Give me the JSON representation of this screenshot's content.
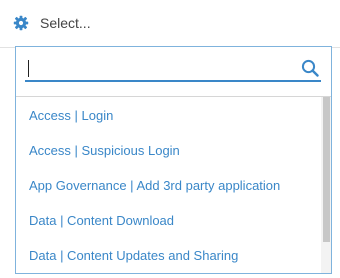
{
  "select": {
    "placeholder": "Select..."
  },
  "search": {
    "value": "",
    "placeholder": ""
  },
  "options": [
    {
      "label": "Access | Login"
    },
    {
      "label": "Access | Suspicious Login"
    },
    {
      "label": "App Governance | Add 3rd party application"
    },
    {
      "label": "Data | Content Download"
    },
    {
      "label": "Data | Content Updates and Sharing"
    }
  ],
  "icons": {
    "trigger": "gear-icon",
    "search": "search-icon"
  },
  "colors": {
    "accent": "#3a87c8",
    "border": "#7fb3dd",
    "text": "#444444"
  }
}
